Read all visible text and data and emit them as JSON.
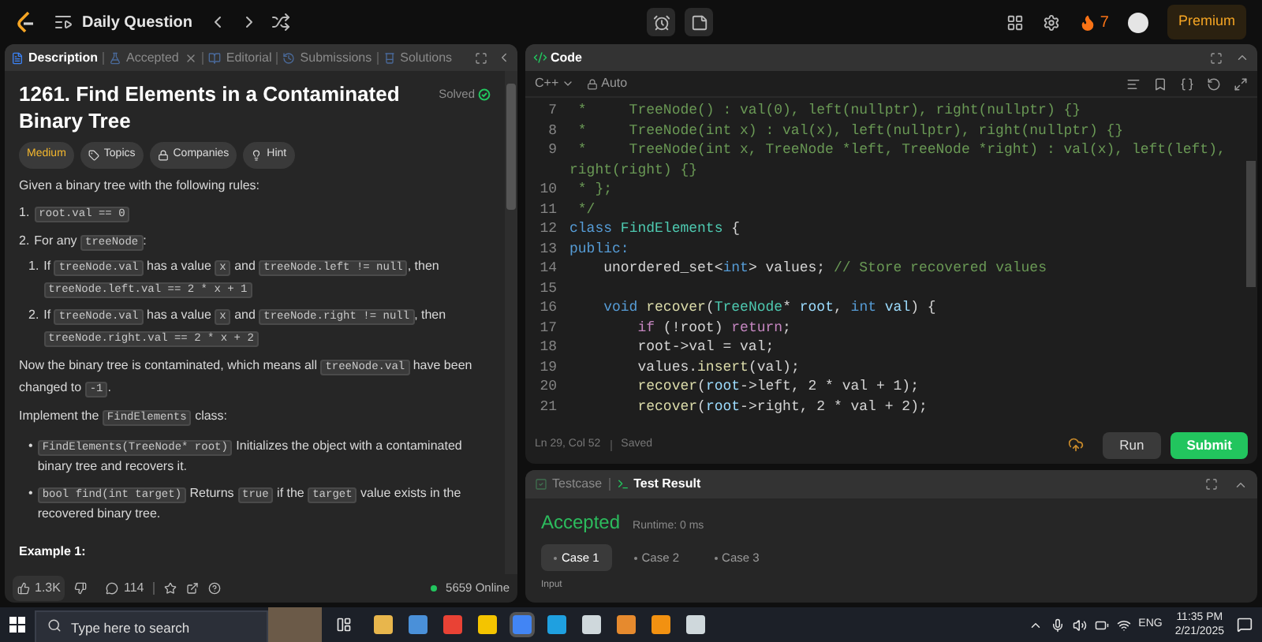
{
  "topbar": {
    "title": "Daily Question",
    "streak": "7",
    "premium": "Premium"
  },
  "problem": {
    "tabs": [
      {
        "label": "Description",
        "selected": true,
        "closable": false
      },
      {
        "label": "Accepted",
        "selected": false,
        "closable": true
      },
      {
        "label": "Editorial",
        "selected": false,
        "closable": false
      },
      {
        "label": "Submissions",
        "selected": false,
        "closable": false
      },
      {
        "label": "Solutions",
        "selected": false,
        "closable": false
      }
    ],
    "title": "1261. Find Elements in a Contaminated Binary Tree",
    "status": "Solved",
    "tags": [
      {
        "label": "Medium",
        "kind": "difficulty"
      },
      {
        "label": "Topics",
        "kind": "topics"
      },
      {
        "label": "Companies",
        "kind": "companies"
      },
      {
        "label": "Hint",
        "kind": "hint"
      }
    ],
    "blocks": [
      {
        "kind": "para",
        "segments": [
          {
            "text": "Given a binary tree with the following rules:",
            "kind": "text"
          }
        ]
      },
      {
        "kind": "ordered",
        "items": [
          {
            "marker": "1.",
            "segments": [
              {
                "text": "root.val == 0",
                "kind": "code"
              }
            ]
          },
          {
            "marker": "2.",
            "segments": [
              {
                "text": "For any ",
                "kind": "text"
              },
              {
                "text": "treeNode",
                "kind": "code"
              },
              {
                "text": ":",
                "kind": "text"
              }
            ],
            "children": [
              {
                "marker": "1.",
                "segments": [
                  {
                    "text": "If ",
                    "kind": "text"
                  },
                  {
                    "text": "treeNode.val",
                    "kind": "code"
                  },
                  {
                    "text": " has a value ",
                    "kind": "text"
                  },
                  {
                    "text": "x",
                    "kind": "code"
                  },
                  {
                    "text": " and ",
                    "kind": "text"
                  },
                  {
                    "text": "treeNode.left != null",
                    "kind": "code"
                  },
                  {
                    "text": ", then ",
                    "kind": "text"
                  },
                  {
                    "text": "treeNode.left.val == 2 * x + 1",
                    "kind": "code"
                  }
                ]
              },
              {
                "marker": "2.",
                "segments": [
                  {
                    "text": "If ",
                    "kind": "text"
                  },
                  {
                    "text": "treeNode.val",
                    "kind": "code"
                  },
                  {
                    "text": " has a value ",
                    "kind": "text"
                  },
                  {
                    "text": "x",
                    "kind": "code"
                  },
                  {
                    "text": " and ",
                    "kind": "text"
                  },
                  {
                    "text": "treeNode.right != null",
                    "kind": "code"
                  },
                  {
                    "text": ", then ",
                    "kind": "text"
                  },
                  {
                    "text": "treeNode.right.val == 2 * x + 2",
                    "kind": "code"
                  }
                ]
              }
            ]
          }
        ]
      },
      {
        "kind": "para",
        "segments": [
          {
            "text": "Now the binary tree is contaminated, which means all ",
            "kind": "text"
          },
          {
            "text": "treeNode.val",
            "kind": "code"
          },
          {
            "text": " have been changed to ",
            "kind": "text"
          },
          {
            "text": "-1",
            "kind": "code"
          },
          {
            "text": ".",
            "kind": "text"
          }
        ]
      },
      {
        "kind": "para",
        "segments": [
          {
            "text": "Implement the ",
            "kind": "text"
          },
          {
            "text": "FindElements",
            "kind": "code"
          },
          {
            "text": " class:",
            "kind": "text"
          }
        ]
      },
      {
        "kind": "bullets",
        "items": [
          {
            "marker": "•",
            "segments": [
              {
                "text": "FindElements(TreeNode* root)",
                "kind": "code"
              },
              {
                "text": " Initializes the object with a contaminated binary tree and recovers it.",
                "kind": "text"
              }
            ]
          },
          {
            "marker": "•",
            "segments": [
              {
                "text": "bool find(int target)",
                "kind": "code"
              },
              {
                "text": " Returns ",
                "kind": "text"
              },
              {
                "text": "true",
                "kind": "code"
              },
              {
                "text": " if the ",
                "kind": "text"
              },
              {
                "text": "target",
                "kind": "code"
              },
              {
                "text": " value exists in the recovered binary tree.",
                "kind": "text"
              }
            ]
          }
        ]
      },
      {
        "kind": "heading",
        "segments": [
          {
            "text": "Example 1:",
            "kind": "text"
          }
        ]
      }
    ],
    "likes": "1.3K",
    "comments": "114",
    "online": "5659 Online"
  },
  "code": {
    "title": "Code",
    "language": "C++",
    "mode": "Auto",
    "lines": [
      {
        "num": "7",
        "tokens": [
          {
            "text": " *     TreeNode() : val(0), left(nullptr), right(nullptr) {}",
            "kind": "comment"
          }
        ]
      },
      {
        "num": "8",
        "tokens": [
          {
            "text": " *     TreeNode(int x) : val(x), left(nullptr), right(nullptr) {}",
            "kind": "comment"
          }
        ]
      },
      {
        "num": "9",
        "tokens": [
          {
            "text": " *     TreeNode(int x, TreeNode *left, TreeNode *right) : val(x), left(left), right(right) {}",
            "kind": "comment"
          }
        ]
      },
      {
        "num": "10",
        "tokens": [
          {
            "text": " * };",
            "kind": "comment"
          }
        ]
      },
      {
        "num": "11",
        "tokens": [
          {
            "text": " */",
            "kind": "comment"
          }
        ]
      },
      {
        "num": "12",
        "tokens": [
          {
            "text": "class",
            "kind": "keyword"
          },
          {
            "text": " FindElements",
            "kind": "type"
          },
          {
            "text": " {",
            "kind": "plain"
          }
        ]
      },
      {
        "num": "13",
        "tokens": [
          {
            "text": "public:",
            "kind": "keyword"
          }
        ]
      },
      {
        "num": "14",
        "tokens": [
          {
            "text": "    unordered_set<",
            "kind": "plain"
          },
          {
            "text": "int",
            "kind": "keyword"
          },
          {
            "text": "> values; ",
            "kind": "plain"
          },
          {
            "text": "// Store recovered values",
            "kind": "comment"
          }
        ]
      },
      {
        "num": "15"
      },
      {
        "num": "16",
        "tokens": [
          {
            "text": "    void",
            "kind": "keyword"
          },
          {
            "text": " recover",
            "kind": "function"
          },
          {
            "text": "(",
            "kind": "plain"
          },
          {
            "text": "TreeNode",
            "kind": "type"
          },
          {
            "text": "* ",
            "kind": "plain"
          },
          {
            "text": "root",
            "kind": "variable"
          },
          {
            "text": ", ",
            "kind": "plain"
          },
          {
            "text": "int",
            "kind": "keyword"
          },
          {
            "text": " val",
            "kind": "variable"
          },
          {
            "text": ") {",
            "kind": "plain"
          }
        ]
      },
      {
        "num": "17",
        "tokens": [
          {
            "text": "        if",
            "kind": "control"
          },
          {
            "text": " (!root) ",
            "kind": "plain"
          },
          {
            "text": "return",
            "kind": "control"
          },
          {
            "text": ";",
            "kind": "plain"
          }
        ]
      },
      {
        "num": "18",
        "tokens": [
          {
            "text": "        root->val = val;",
            "kind": "plain"
          }
        ]
      },
      {
        "num": "19",
        "tokens": [
          {
            "text": "        values.",
            "kind": "plain"
          },
          {
            "text": "insert",
            "kind": "function"
          },
          {
            "text": "(val);",
            "kind": "plain"
          }
        ]
      },
      {
        "num": "20",
        "tokens": [
          {
            "text": "        recover",
            "kind": "function"
          },
          {
            "text": "(",
            "kind": "plain"
          },
          {
            "text": "root",
            "kind": "variable"
          },
          {
            "text": "->left, 2 * val + 1);",
            "kind": "plain"
          }
        ]
      },
      {
        "num": "21",
        "tokens": [
          {
            "text": "        recover",
            "kind": "function"
          },
          {
            "text": "(",
            "kind": "plain"
          },
          {
            "text": "root",
            "kind": "variable"
          },
          {
            "text": "->right, 2 * val + 2);",
            "kind": "plain"
          }
        ]
      }
    ],
    "cursor": "Ln 29, Col 52",
    "saved": "Saved",
    "run": "Run",
    "submit": "Submit"
  },
  "test": {
    "tabs": [
      {
        "label": "Testcase",
        "selected": false
      },
      {
        "label": "Test Result",
        "selected": true
      }
    ],
    "verdict": "Accepted",
    "runtime": "Runtime: 0 ms",
    "cases": [
      {
        "label": "Case 1",
        "selected": true
      },
      {
        "label": "Case 2",
        "selected": false
      },
      {
        "label": "Case 3",
        "selected": false
      }
    ],
    "input_label": "Input"
  },
  "taskbar": {
    "search_placeholder": "Type here to search",
    "language": "ENG",
    "time": "11:35 PM",
    "date": "2/21/2025"
  }
}
